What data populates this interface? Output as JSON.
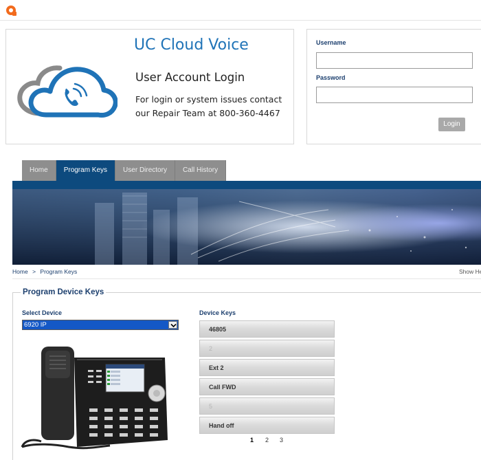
{
  "brand": {
    "title": "UC Cloud Voice",
    "heading": "User Account Login",
    "contact": "For login or system issues contact our Repair Team at 800-360-4467",
    "colors": {
      "accent": "#1f73b7",
      "logo": "#f26b1d"
    }
  },
  "login": {
    "username_label": "Username",
    "username_value": "",
    "password_label": "Password",
    "password_value": "",
    "button_label": "Login"
  },
  "nav": {
    "tabs": [
      {
        "label": "Home",
        "active": false
      },
      {
        "label": "Program Keys",
        "active": true
      },
      {
        "label": "User Directory",
        "active": false
      },
      {
        "label": "Call History",
        "active": false
      }
    ],
    "color": "#0d4a7e"
  },
  "breadcrumb": {
    "home": "Home",
    "separator": ">",
    "current": "Program Keys",
    "help": "Show He"
  },
  "program": {
    "title": "Program Device Keys",
    "select_label": "Select Device",
    "selected_device": "6920 IP",
    "keys_label": "Device Keys",
    "keys": [
      "46805",
      "2",
      "Ext 2",
      "Call FWD",
      "5",
      "Hand off"
    ],
    "pages": [
      "1",
      "2",
      "3"
    ],
    "current_page": "1"
  }
}
